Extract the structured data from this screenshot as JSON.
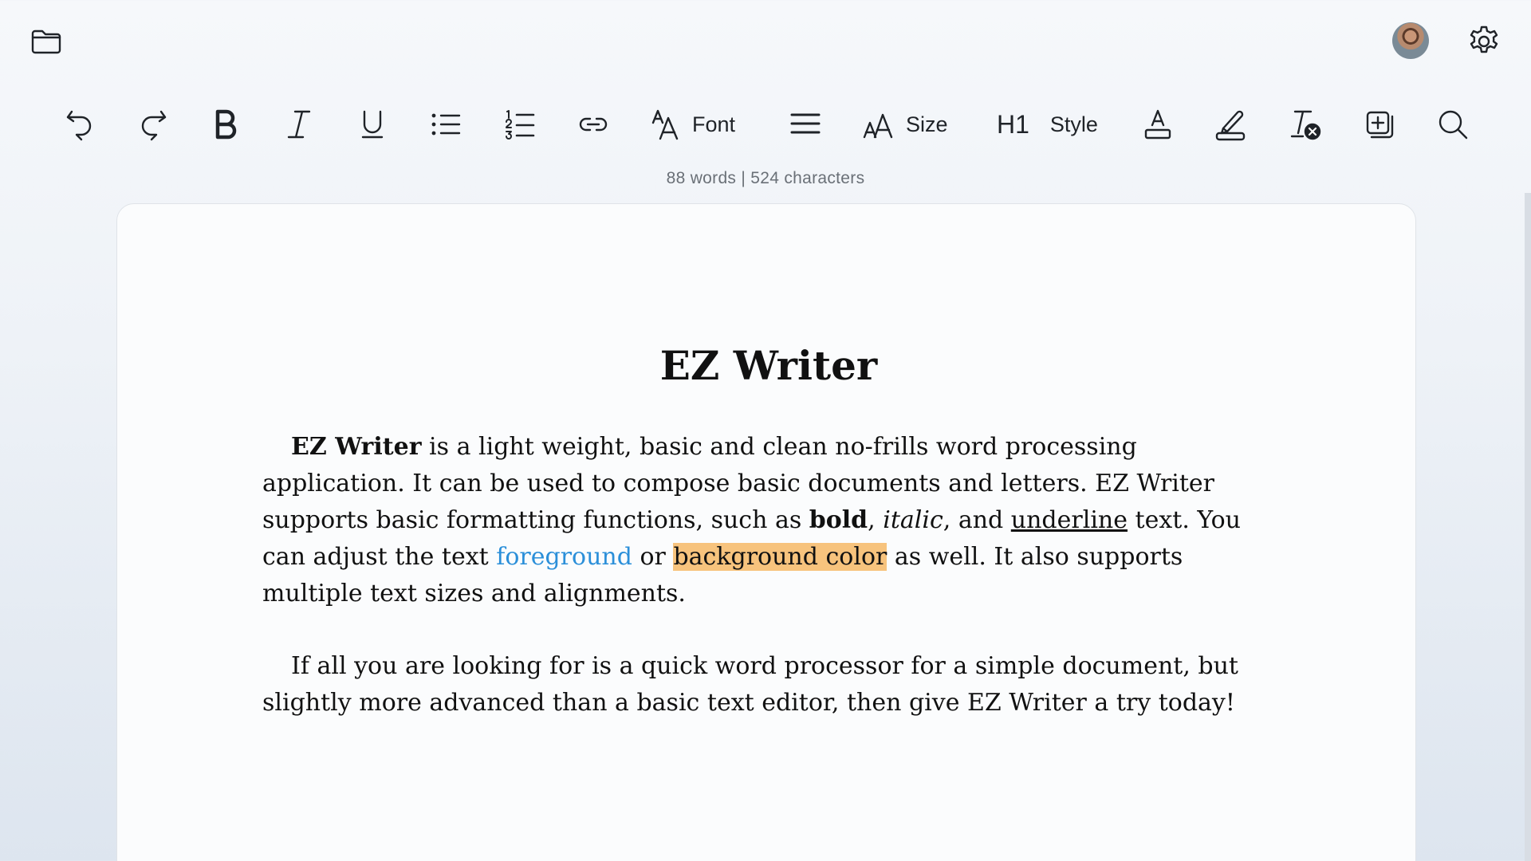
{
  "topbar": {
    "folder_icon": "folder-icon",
    "avatar_icon": "avatar",
    "settings_icon": "gear-icon"
  },
  "toolbar": {
    "undo": "undo-icon",
    "redo": "redo-icon",
    "bold": "bold-icon",
    "italic": "italic-icon",
    "underline": "underline-icon",
    "bullet_list": "bullet-list-icon",
    "numbered_list": "numbered-list-icon",
    "link": "link-icon",
    "font_label": "Font",
    "align": "align-icon",
    "size_label": "Size",
    "heading_glyph": "H1",
    "style_label": "Style",
    "text_color": "text-color-icon",
    "highlight": "highlighter-icon",
    "clear_format": "clear-format-icon",
    "insert": "insert-icon",
    "search": "search-icon"
  },
  "status": {
    "word_count": "88 words | 524 characters"
  },
  "document": {
    "title": "EZ Writer",
    "p1": {
      "bold_intro": "EZ Writer",
      "t1": " is a light weight, basic and clean no-frills word processing application.  It can be used to compose basic documents and letters.  EZ Writer supports basic formatting functions, such as ",
      "bold": "bold",
      "t2": ", ",
      "italic": "italic",
      "t3": ", and ",
      "underline": "underline",
      "t4": " text.  You can adjust the text ",
      "foreground": "foreground",
      "t5": " or ",
      "background": "background color",
      "t6": " as well.  It also supports multiple text sizes and alignments."
    },
    "p2": "If all you are looking for is a quick word processor for a simple document, but slightly more advanced than a basic text editor, then give EZ Writer a try today!"
  },
  "colors": {
    "foreground_text": "#2b8fd9",
    "highlight_background": "#f7c37d"
  }
}
